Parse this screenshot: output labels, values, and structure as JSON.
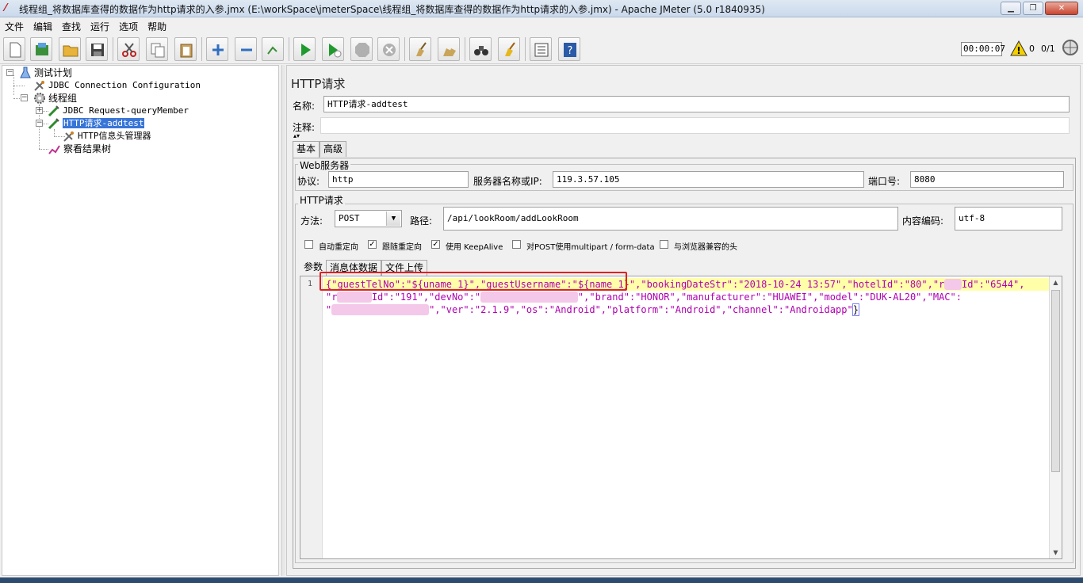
{
  "window": {
    "title": "线程组_将数据库查得的数据作为http请求的入参.jmx (E:\\workSpace\\jmeterSpace\\线程组_将数据库查得的数据作为http请求的入参.jmx) - Apache JMeter (5.0 r1840935)",
    "min_label": "▁",
    "max_label": "❐",
    "close_label": "✕"
  },
  "menu": [
    "文件",
    "编辑",
    "查找",
    "运行",
    "选项",
    "帮助"
  ],
  "toolbar": {
    "icons": [
      "new-icon",
      "templates-icon",
      "open-icon",
      "save-icon",
      "cut-icon",
      "copy-icon",
      "paste-icon",
      "expand-icon",
      "collapse-icon",
      "toggle-icon",
      "start-icon",
      "start-no-pause-icon",
      "stop-icon",
      "shutdown-icon",
      "clear-icon",
      "clear-all-icon",
      "search-icon",
      "reset-search-icon",
      "function-helper-icon",
      "help-icon"
    ],
    "timer": "00:00:07",
    "error_count": "0",
    "thread_count": "0/1"
  },
  "tree": {
    "items": [
      {
        "label": "测试计划",
        "icon": "test-plan-icon"
      },
      {
        "label": "JDBC Connection Configuration",
        "icon": "config-icon"
      },
      {
        "label": "线程组",
        "icon": "thread-group-icon"
      },
      {
        "label": "JDBC Request-queryMember",
        "icon": "sampler-icon"
      },
      {
        "label": "HTTP请求-addtest",
        "icon": "sampler-icon"
      },
      {
        "label": "HTTP信息头管理器",
        "icon": "config-icon"
      },
      {
        "label": "察看结果树",
        "icon": "listener-icon"
      }
    ]
  },
  "panel": {
    "title": "HTTP请求",
    "name_label": "名称:",
    "name_value": "HTTP请求-addtest",
    "comment_label": "注释:",
    "comment_value": "",
    "tabs": [
      "基本",
      "高级"
    ],
    "web_server": {
      "group_title": "Web服务器",
      "protocol_label": "协议:",
      "protocol_value": "http",
      "server_label": "服务器名称或IP:",
      "server_value": "119.3.57.105",
      "port_label": "端口号:",
      "port_value": "8080"
    },
    "http_request": {
      "group_title": "HTTP请求",
      "method_label": "方法:",
      "method_value": "POST",
      "path_label": "路径:",
      "path_value": "/api/lookRoom/addLookRoom",
      "encoding_label": "内容编码:",
      "encoding_value": "utf-8"
    },
    "checkboxes": [
      {
        "label": "自动重定向",
        "checked": false
      },
      {
        "label": "跟随重定向",
        "checked": true
      },
      {
        "label": "使用 KeepAlive",
        "checked": true
      },
      {
        "label": "对POST使用multipart / form-data",
        "checked": false
      },
      {
        "label": "与浏览器兼容的头",
        "checked": false
      }
    ],
    "body_tabs": [
      "参数",
      "消息体数据",
      "文件上传"
    ],
    "body": {
      "line_number": "1",
      "line1_a": "{\"guestTelNo\":\"${uname 1}\",\"guestUsername\":\"${name 1}\"",
      "line1_b": ",\"bookingDateStr\":\"2018-10-24 13:57\",\"hotelId\":\"80\",\"r",
      "line1_c": "Id\":\"6544\",",
      "line2_a": "\"r",
      "line2_b": "Id\":\"191\",\"devNo\":\"",
      "line2_c": "\",\"brand\":\"HONOR\",\"manufacturer\":\"HUAWEI\",\"model\":\"DUK-AL20\",\"MAC\":",
      "line3_a": "\"",
      "line3_b": "\",\"ver\":\"2.1.9\",\"os\":\"Android\",\"platform\":\"Android\",\"channel\":\"Androidapp\"",
      "line3_c": "}"
    }
  }
}
